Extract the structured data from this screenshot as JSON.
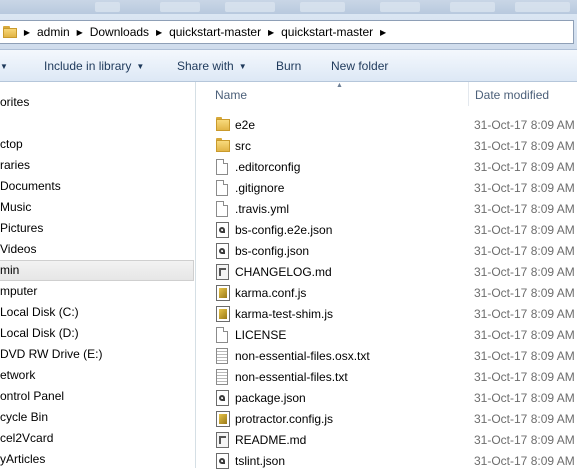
{
  "breadcrumb": [
    "admin",
    "Downloads",
    "quickstart-master",
    "quickstart-master"
  ],
  "toolbar": {
    "include_label": "Include in library",
    "share_label": "Share with",
    "burn_label": "Burn",
    "new_folder_label": "New folder"
  },
  "nav": {
    "items": [
      {
        "label": "orites",
        "icon": "star-icon"
      },
      {
        "label": "ctop",
        "icon": "desktop-icon"
      },
      {
        "label": "raries",
        "icon": "library-icon"
      },
      {
        "label": "Documents",
        "icon": "documents-icon"
      },
      {
        "label": "Music",
        "icon": "music-icon"
      },
      {
        "label": "Pictures",
        "icon": "pictures-icon"
      },
      {
        "label": "Videos",
        "icon": "videos-icon"
      },
      {
        "label": "min",
        "icon": "user-icon",
        "selected": true
      },
      {
        "label": "mputer",
        "icon": "computer-icon"
      },
      {
        "label": "Local Disk (C:)",
        "icon": "disk-icon"
      },
      {
        "label": "Local Disk (D:)",
        "icon": "disk-icon"
      },
      {
        "label": "DVD RW Drive (E:)",
        "icon": "dvd-icon"
      },
      {
        "label": "etwork",
        "icon": "network-icon"
      },
      {
        "label": "ontrol Panel",
        "icon": "control-panel-icon"
      },
      {
        "label": "cycle Bin",
        "icon": "recycle-bin-icon"
      },
      {
        "label": "cel2Vcard",
        "icon": "folder-icon"
      },
      {
        "label": "yArticles",
        "icon": "folder-icon"
      }
    ]
  },
  "columns": {
    "name": "Name",
    "date": "Date modified"
  },
  "files": [
    {
      "name": "e2e",
      "date": "31-Oct-17 8:09 AM",
      "icon": "folder-icon"
    },
    {
      "name": "src",
      "date": "31-Oct-17 8:09 AM",
      "icon": "folder-icon"
    },
    {
      "name": ".editorconfig",
      "date": "31-Oct-17 8:09 AM",
      "icon": "file-icon"
    },
    {
      "name": ".gitignore",
      "date": "31-Oct-17 8:09 AM",
      "icon": "file-icon"
    },
    {
      "name": ".travis.yml",
      "date": "31-Oct-17 8:09 AM",
      "icon": "file-icon"
    },
    {
      "name": "bs-config.e2e.json",
      "date": "31-Oct-17 8:09 AM",
      "icon": "json-icon"
    },
    {
      "name": "bs-config.json",
      "date": "31-Oct-17 8:09 AM",
      "icon": "json-icon"
    },
    {
      "name": "CHANGELOG.md",
      "date": "31-Oct-17 8:09 AM",
      "icon": "markdown-icon"
    },
    {
      "name": "karma.conf.js",
      "date": "31-Oct-17 8:09 AM",
      "icon": "js-icon"
    },
    {
      "name": "karma-test-shim.js",
      "date": "31-Oct-17 8:09 AM",
      "icon": "js-icon"
    },
    {
      "name": "LICENSE",
      "date": "31-Oct-17 8:09 AM",
      "icon": "file-icon"
    },
    {
      "name": "non-essential-files.osx.txt",
      "date": "31-Oct-17 8:09 AM",
      "icon": "text-file-icon"
    },
    {
      "name": "non-essential-files.txt",
      "date": "31-Oct-17 8:09 AM",
      "icon": "text-file-icon"
    },
    {
      "name": "package.json",
      "date": "31-Oct-17 8:09 AM",
      "icon": "json-icon"
    },
    {
      "name": "protractor.config.js",
      "date": "31-Oct-17 8:09 AM",
      "icon": "js-icon"
    },
    {
      "name": "README.md",
      "date": "31-Oct-17 8:09 AM",
      "icon": "markdown-icon"
    },
    {
      "name": "tslint.json",
      "date": "31-Oct-17 8:09 AM",
      "icon": "json-icon"
    }
  ]
}
